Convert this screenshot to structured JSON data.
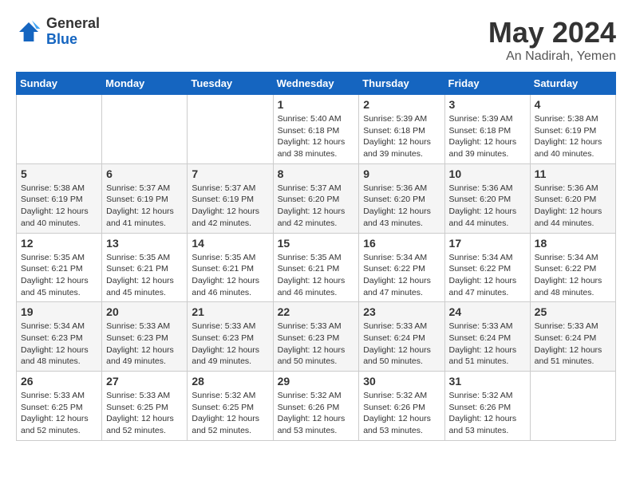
{
  "logo": {
    "general": "General",
    "blue": "Blue"
  },
  "title": "May 2024",
  "location": "An Nadirah, Yemen",
  "days_of_week": [
    "Sunday",
    "Monday",
    "Tuesday",
    "Wednesday",
    "Thursday",
    "Friday",
    "Saturday"
  ],
  "weeks": [
    [
      {
        "day": "",
        "info": ""
      },
      {
        "day": "",
        "info": ""
      },
      {
        "day": "",
        "info": ""
      },
      {
        "day": "1",
        "info": "Sunrise: 5:40 AM\nSunset: 6:18 PM\nDaylight: 12 hours\nand 38 minutes."
      },
      {
        "day": "2",
        "info": "Sunrise: 5:39 AM\nSunset: 6:18 PM\nDaylight: 12 hours\nand 39 minutes."
      },
      {
        "day": "3",
        "info": "Sunrise: 5:39 AM\nSunset: 6:18 PM\nDaylight: 12 hours\nand 39 minutes."
      },
      {
        "day": "4",
        "info": "Sunrise: 5:38 AM\nSunset: 6:19 PM\nDaylight: 12 hours\nand 40 minutes."
      }
    ],
    [
      {
        "day": "5",
        "info": "Sunrise: 5:38 AM\nSunset: 6:19 PM\nDaylight: 12 hours\nand 40 minutes."
      },
      {
        "day": "6",
        "info": "Sunrise: 5:37 AM\nSunset: 6:19 PM\nDaylight: 12 hours\nand 41 minutes."
      },
      {
        "day": "7",
        "info": "Sunrise: 5:37 AM\nSunset: 6:19 PM\nDaylight: 12 hours\nand 42 minutes."
      },
      {
        "day": "8",
        "info": "Sunrise: 5:37 AM\nSunset: 6:20 PM\nDaylight: 12 hours\nand 42 minutes."
      },
      {
        "day": "9",
        "info": "Sunrise: 5:36 AM\nSunset: 6:20 PM\nDaylight: 12 hours\nand 43 minutes."
      },
      {
        "day": "10",
        "info": "Sunrise: 5:36 AM\nSunset: 6:20 PM\nDaylight: 12 hours\nand 44 minutes."
      },
      {
        "day": "11",
        "info": "Sunrise: 5:36 AM\nSunset: 6:20 PM\nDaylight: 12 hours\nand 44 minutes."
      }
    ],
    [
      {
        "day": "12",
        "info": "Sunrise: 5:35 AM\nSunset: 6:21 PM\nDaylight: 12 hours\nand 45 minutes."
      },
      {
        "day": "13",
        "info": "Sunrise: 5:35 AM\nSunset: 6:21 PM\nDaylight: 12 hours\nand 45 minutes."
      },
      {
        "day": "14",
        "info": "Sunrise: 5:35 AM\nSunset: 6:21 PM\nDaylight: 12 hours\nand 46 minutes."
      },
      {
        "day": "15",
        "info": "Sunrise: 5:35 AM\nSunset: 6:21 PM\nDaylight: 12 hours\nand 46 minutes."
      },
      {
        "day": "16",
        "info": "Sunrise: 5:34 AM\nSunset: 6:22 PM\nDaylight: 12 hours\nand 47 minutes."
      },
      {
        "day": "17",
        "info": "Sunrise: 5:34 AM\nSunset: 6:22 PM\nDaylight: 12 hours\nand 47 minutes."
      },
      {
        "day": "18",
        "info": "Sunrise: 5:34 AM\nSunset: 6:22 PM\nDaylight: 12 hours\nand 48 minutes."
      }
    ],
    [
      {
        "day": "19",
        "info": "Sunrise: 5:34 AM\nSunset: 6:23 PM\nDaylight: 12 hours\nand 48 minutes."
      },
      {
        "day": "20",
        "info": "Sunrise: 5:33 AM\nSunset: 6:23 PM\nDaylight: 12 hours\nand 49 minutes."
      },
      {
        "day": "21",
        "info": "Sunrise: 5:33 AM\nSunset: 6:23 PM\nDaylight: 12 hours\nand 49 minutes."
      },
      {
        "day": "22",
        "info": "Sunrise: 5:33 AM\nSunset: 6:23 PM\nDaylight: 12 hours\nand 50 minutes."
      },
      {
        "day": "23",
        "info": "Sunrise: 5:33 AM\nSunset: 6:24 PM\nDaylight: 12 hours\nand 50 minutes."
      },
      {
        "day": "24",
        "info": "Sunrise: 5:33 AM\nSunset: 6:24 PM\nDaylight: 12 hours\nand 51 minutes."
      },
      {
        "day": "25",
        "info": "Sunrise: 5:33 AM\nSunset: 6:24 PM\nDaylight: 12 hours\nand 51 minutes."
      }
    ],
    [
      {
        "day": "26",
        "info": "Sunrise: 5:33 AM\nSunset: 6:25 PM\nDaylight: 12 hours\nand 52 minutes."
      },
      {
        "day": "27",
        "info": "Sunrise: 5:33 AM\nSunset: 6:25 PM\nDaylight: 12 hours\nand 52 minutes."
      },
      {
        "day": "28",
        "info": "Sunrise: 5:32 AM\nSunset: 6:25 PM\nDaylight: 12 hours\nand 52 minutes."
      },
      {
        "day": "29",
        "info": "Sunrise: 5:32 AM\nSunset: 6:26 PM\nDaylight: 12 hours\nand 53 minutes."
      },
      {
        "day": "30",
        "info": "Sunrise: 5:32 AM\nSunset: 6:26 PM\nDaylight: 12 hours\nand 53 minutes."
      },
      {
        "day": "31",
        "info": "Sunrise: 5:32 AM\nSunset: 6:26 PM\nDaylight: 12 hours\nand 53 minutes."
      },
      {
        "day": "",
        "info": ""
      }
    ]
  ]
}
